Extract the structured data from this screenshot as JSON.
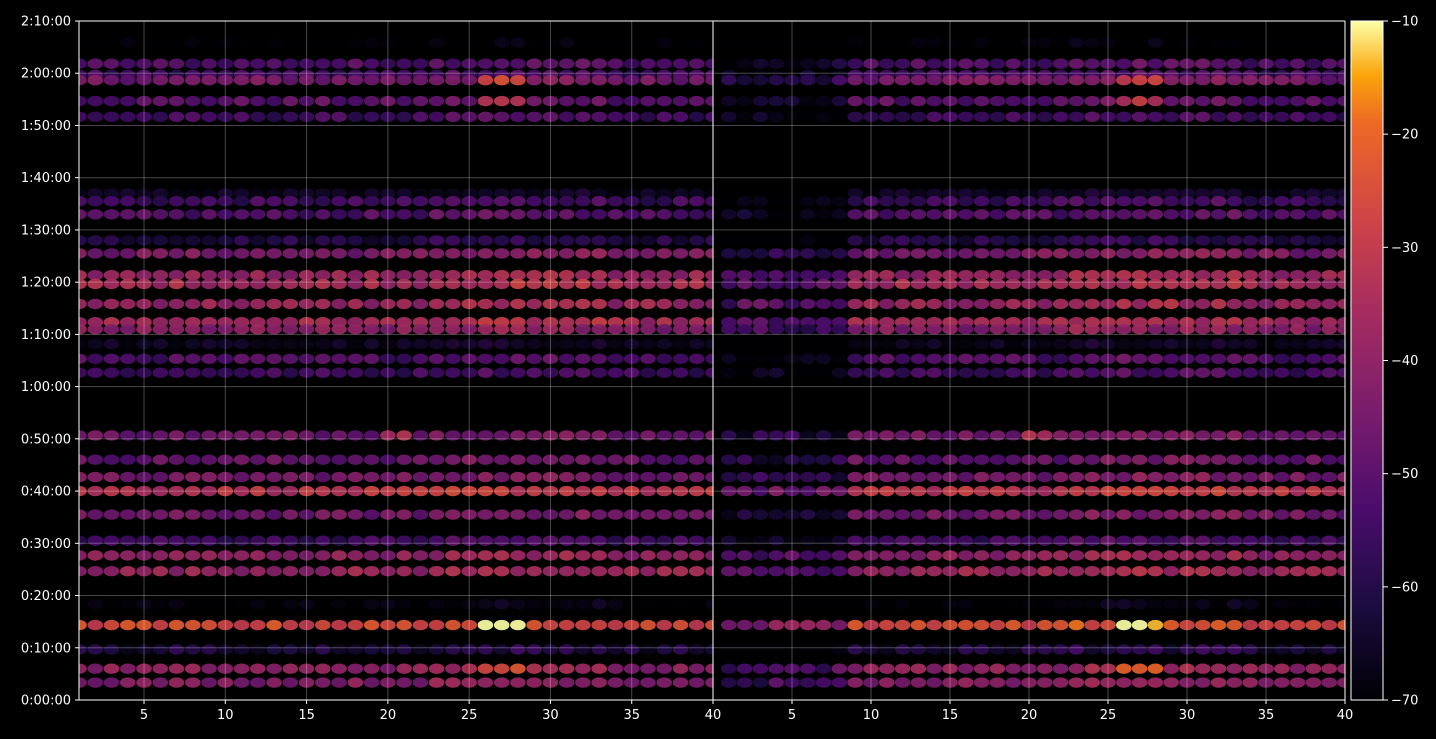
{
  "chart_data": {
    "type": "heatmap",
    "title": "",
    "xlabel": "",
    "ylabel": "",
    "colormap": "inferno",
    "background": "#000000",
    "colorbar": {
      "range": [
        -70,
        -10
      ],
      "ticks": [
        -70,
        -60,
        -50,
        -40,
        -30,
        -20,
        -10
      ],
      "tick_labels": [
        "−70",
        "−60",
        "−50",
        "−40",
        "−30",
        "−20",
        "−10"
      ]
    },
    "y_axis": {
      "unit": "seconds",
      "range": [
        0,
        7800
      ],
      "ticks": [
        0,
        600,
        1200,
        1800,
        2400,
        3000,
        3600,
        4200,
        4800,
        5400,
        6000,
        6600,
        7200,
        7800
      ],
      "tick_labels": [
        "0:00:00",
        "0:10:00",
        "0:20:00",
        "0:30:00",
        "0:40:00",
        "0:50:00",
        "1:00:00",
        "1:10:00",
        "1:20:00",
        "1:30:00",
        "1:40:00",
        "1:50:00",
        "2:00:00",
        "2:10:00"
      ]
    },
    "panels": [
      {
        "name": "left",
        "x_range": [
          1,
          40
        ],
        "x_ticks": [
          5,
          10,
          15,
          20,
          25,
          30,
          35,
          40
        ],
        "x_tick_labels": [
          "5",
          "10",
          "15",
          "20",
          "25",
          "30",
          "35",
          "40"
        ]
      },
      {
        "name": "right",
        "x_range": [
          0,
          40
        ],
        "x_ticks": [
          5,
          10,
          15,
          20,
          25,
          30,
          35,
          40
        ],
        "x_tick_labels": [
          "5",
          "10",
          "15",
          "20",
          "25",
          "30",
          "35",
          "40"
        ]
      }
    ],
    "grid": true,
    "legend": "none",
    "bands": [
      {
        "t": 7550,
        "level": -68,
        "faint": true
      },
      {
        "t": 7310,
        "level": -52
      },
      {
        "t": 7180,
        "level": -55
      },
      {
        "t": 7120,
        "level": -45,
        "hot": [
          26,
          28
        ]
      },
      {
        "t": 6880,
        "level": -50,
        "hot": [
          26,
          28
        ]
      },
      {
        "t": 6700,
        "level": -55
      },
      {
        "t": 5820,
        "level": -60,
        "faint": true
      },
      {
        "t": 5730,
        "level": -55
      },
      {
        "t": 5580,
        "level": -52
      },
      {
        "t": 5280,
        "level": -60
      },
      {
        "t": 5130,
        "level": -44
      },
      {
        "t": 4880,
        "level": -38
      },
      {
        "t": 4780,
        "level": -35
      },
      {
        "t": 4550,
        "level": -38
      },
      {
        "t": 4340,
        "level": -36
      },
      {
        "t": 4260,
        "level": -42
      },
      {
        "t": 4090,
        "level": -60,
        "faint": true
      },
      {
        "t": 3920,
        "level": -52
      },
      {
        "t": 3760,
        "level": -55
      },
      {
        "t": 3040,
        "level": -46,
        "hot": [
          20,
          21
        ]
      },
      {
        "t": 2760,
        "level": -48
      },
      {
        "t": 2560,
        "level": -45
      },
      {
        "t": 2400,
        "level": -32
      },
      {
        "t": 2130,
        "level": -46
      },
      {
        "t": 1830,
        "level": -55
      },
      {
        "t": 1660,
        "level": -40
      },
      {
        "t": 1480,
        "level": -38
      },
      {
        "t": 1100,
        "level": -65,
        "faint": true
      },
      {
        "t": 860,
        "level": -26,
        "hot": [
          26,
          28
        ]
      },
      {
        "t": 580,
        "level": -62
      },
      {
        "t": 360,
        "level": -40,
        "hot": [
          26,
          28
        ]
      },
      {
        "t": 200,
        "level": -42
      }
    ]
  }
}
